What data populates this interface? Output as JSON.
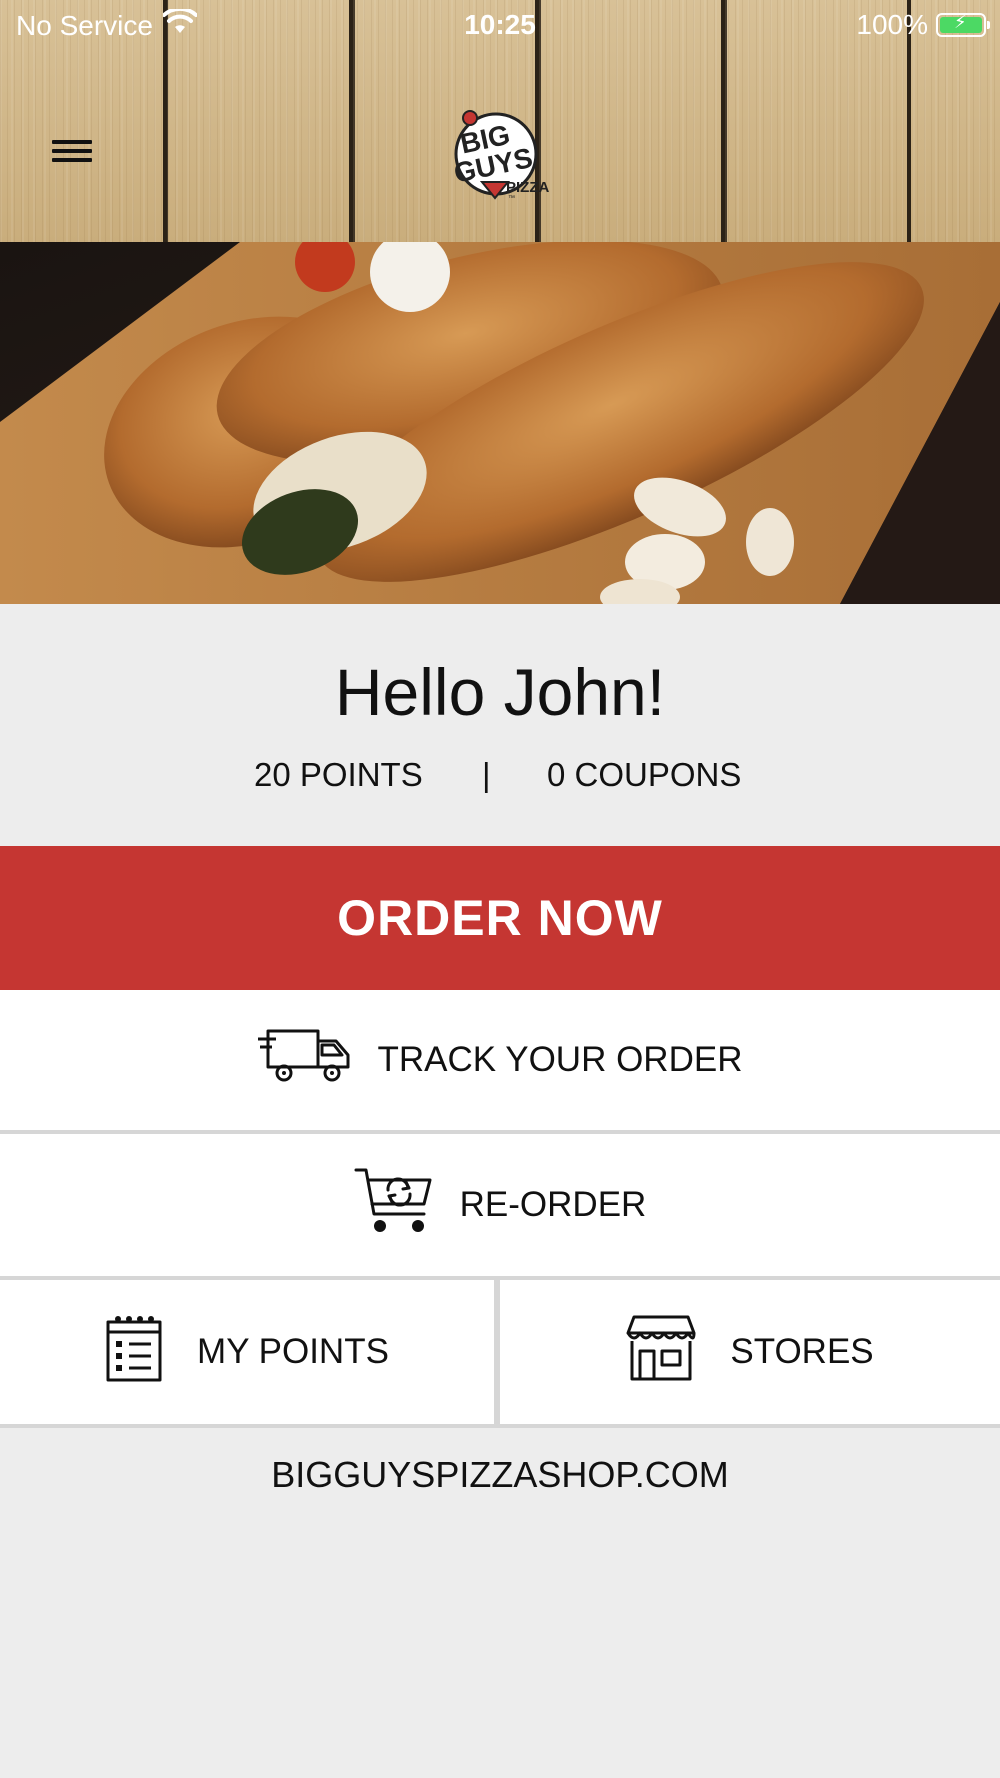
{
  "status_bar": {
    "carrier": "No Service",
    "time": "10:25",
    "battery_percent": "100%"
  },
  "header": {
    "logo_line1": "BIG",
    "logo_line2": "GUYS",
    "logo_line3": "PIZZA",
    "logo_tm": "™"
  },
  "welcome": {
    "greeting": "Hello John!",
    "points": "20 POINTS",
    "separator": "|",
    "coupons": "0 COUPONS"
  },
  "actions": {
    "order_now": "ORDER NOW",
    "track_order": "TRACK YOUR ORDER",
    "reorder": "RE-ORDER",
    "my_points": "MY POINTS",
    "stores": "STORES"
  },
  "footer": {
    "website": "BIGGUYSPIZZASHOP.COM"
  },
  "colors": {
    "accent_red": "#c53632",
    "background": "#ededed",
    "wood": "#cfb589"
  },
  "icons": [
    "menu-icon",
    "wifi-icon",
    "battery-icon",
    "delivery-truck-icon",
    "cart-refresh-icon",
    "points-notepad-icon",
    "store-icon"
  ]
}
